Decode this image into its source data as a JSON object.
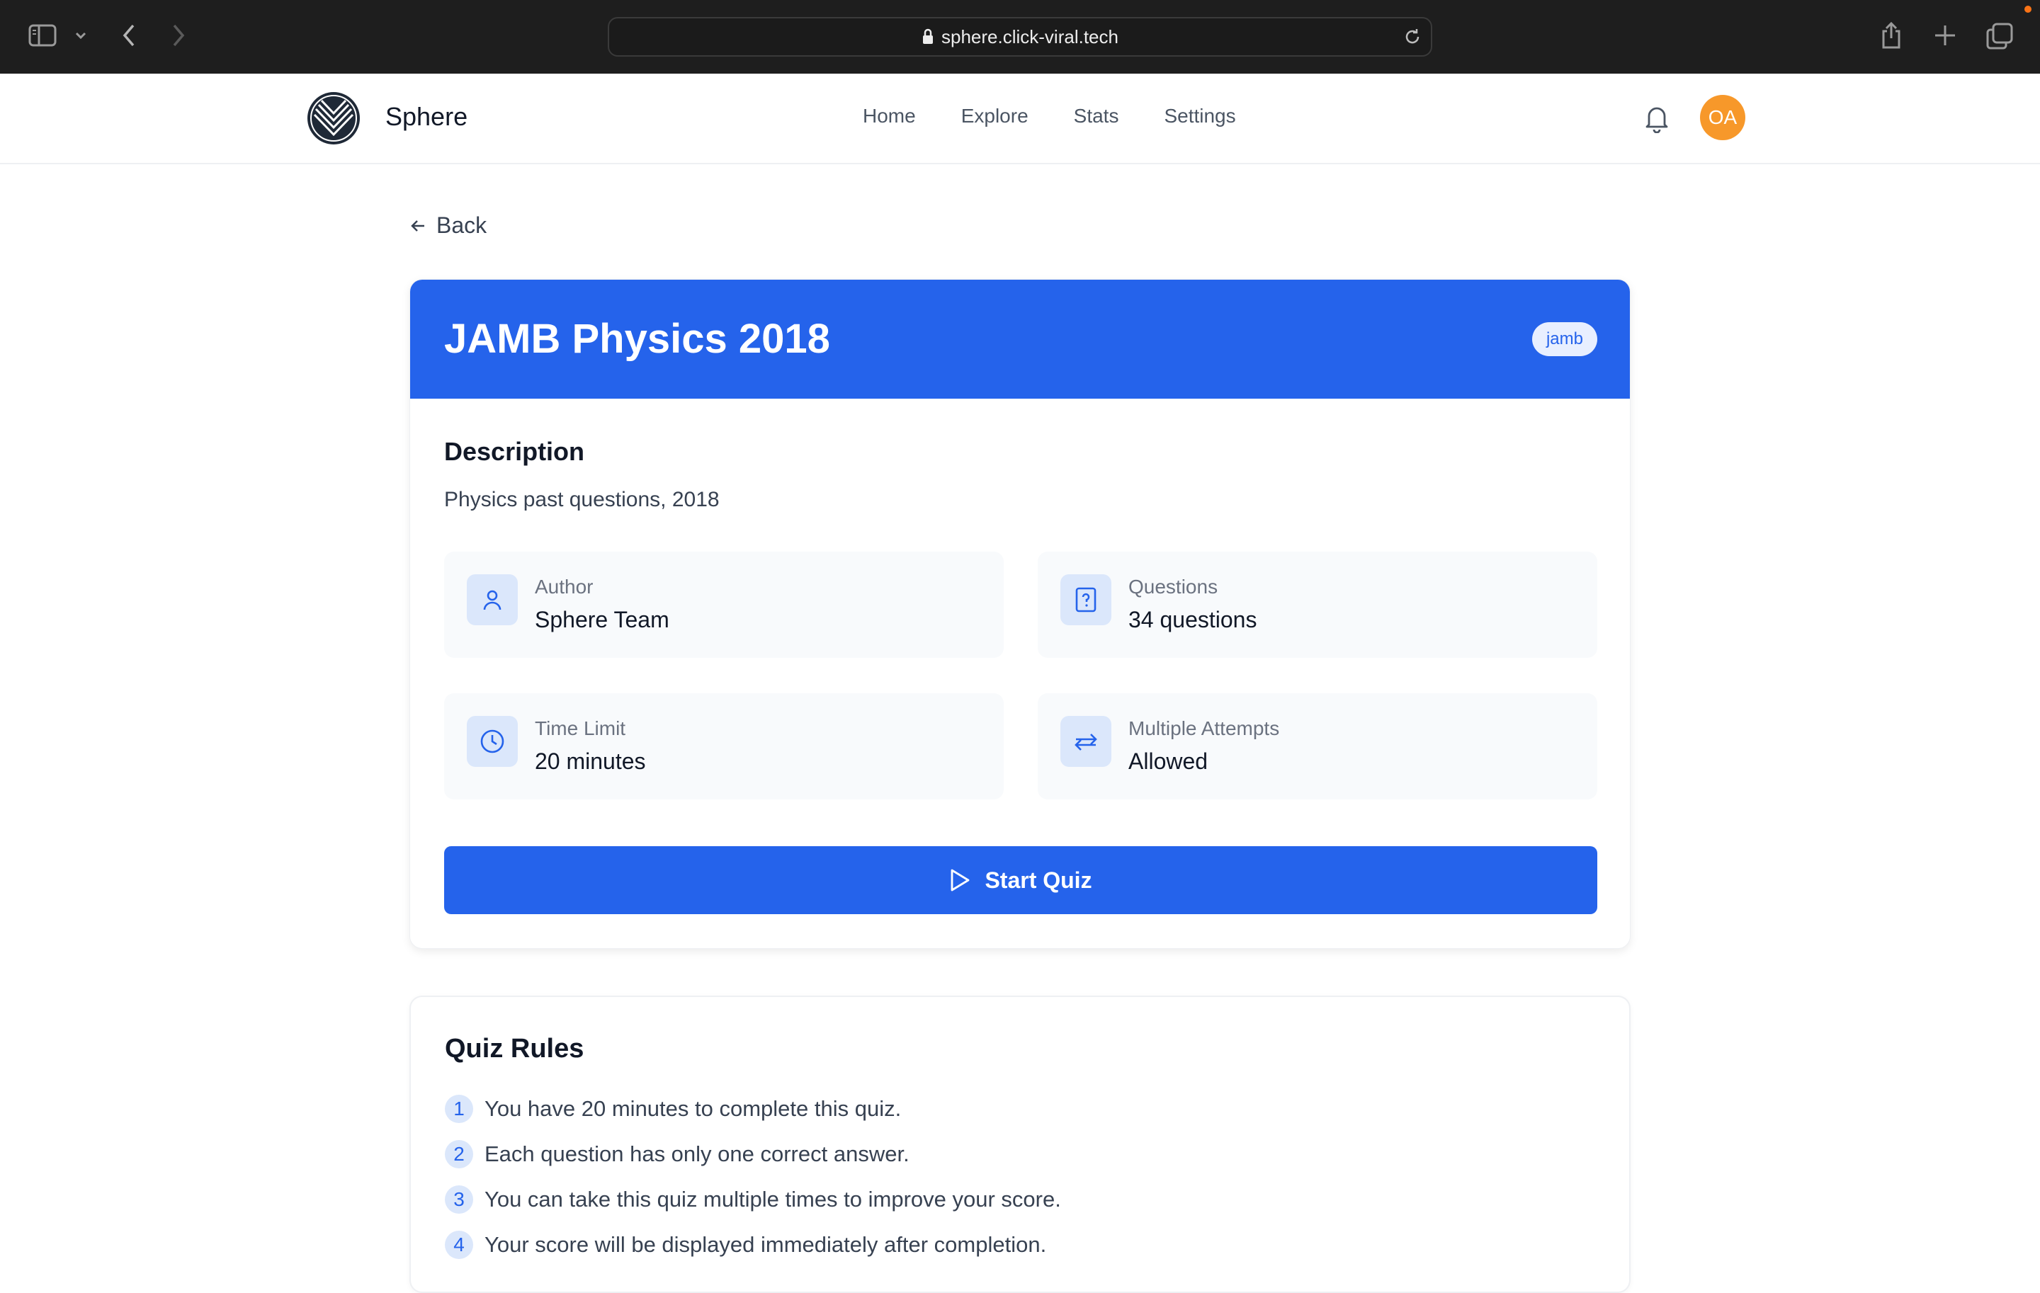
{
  "browser": {
    "url": "sphere.click-viral.tech"
  },
  "header": {
    "brand": "Sphere",
    "nav": [
      "Home",
      "Explore",
      "Stats",
      "Settings"
    ],
    "avatar_initials": "OA"
  },
  "back_label": "Back",
  "quiz": {
    "title": "JAMB Physics 2018",
    "tag": "jamb",
    "description_heading": "Description",
    "description": "Physics past questions, 2018",
    "info": [
      {
        "label": "Author",
        "value": "Sphere Team",
        "icon": "user-icon"
      },
      {
        "label": "Questions",
        "value": "34 questions",
        "icon": "question-file-icon"
      },
      {
        "label": "Time Limit",
        "value": "20 minutes",
        "icon": "clock-icon"
      },
      {
        "label": "Multiple Attempts",
        "value": "Allowed",
        "icon": "repeat-icon"
      }
    ],
    "start_label": "Start Quiz"
  },
  "rules": {
    "heading": "Quiz Rules",
    "items": [
      {
        "num": "1",
        "text": "You have 20 minutes to complete this quiz."
      },
      {
        "num": "2",
        "text": "Each question has only one correct answer."
      },
      {
        "num": "3",
        "text": "You can take this quiz multiple times to improve your score."
      },
      {
        "num": "4",
        "text": "Your score will be displayed immediately after completion."
      }
    ]
  },
  "colors": {
    "primary": "#2563eb",
    "avatar": "#f7982a",
    "chrome": "#1e1e1e"
  }
}
